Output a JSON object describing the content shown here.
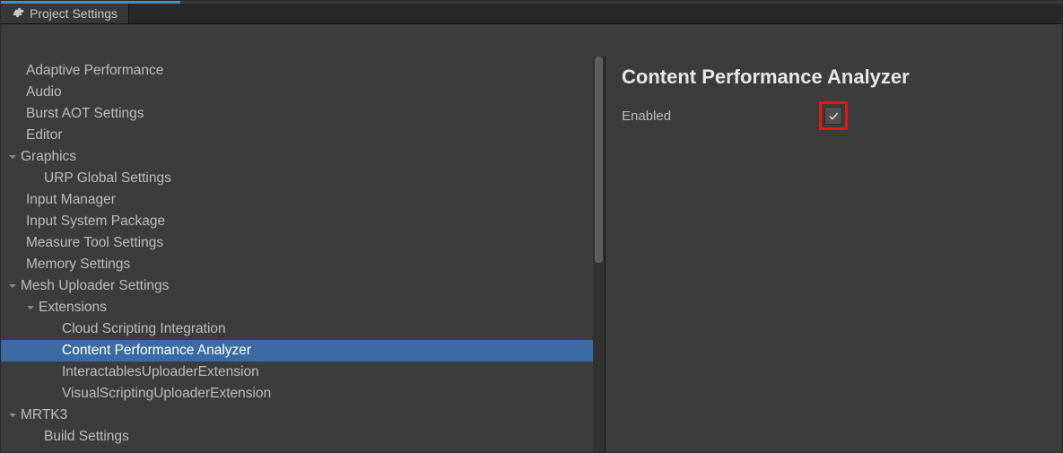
{
  "tab": {
    "title": "Project Settings",
    "icon": "gear-icon"
  },
  "tree": [
    {
      "label": "Adaptive Performance",
      "depth": 1,
      "children": false,
      "selected": false
    },
    {
      "label": "Audio",
      "depth": 1,
      "children": false,
      "selected": false
    },
    {
      "label": "Burst AOT Settings",
      "depth": 1,
      "children": false,
      "selected": false
    },
    {
      "label": "Editor",
      "depth": 1,
      "children": false,
      "selected": false
    },
    {
      "label": "Graphics",
      "depth": 0,
      "children": true,
      "expanded": true,
      "selected": false
    },
    {
      "label": "URP Global Settings",
      "depth": 2,
      "children": false,
      "selected": false
    },
    {
      "label": "Input Manager",
      "depth": 1,
      "children": false,
      "selected": false
    },
    {
      "label": "Input System Package",
      "depth": 1,
      "children": false,
      "selected": false
    },
    {
      "label": "Measure Tool Settings",
      "depth": 1,
      "children": false,
      "selected": false
    },
    {
      "label": "Memory Settings",
      "depth": 1,
      "children": false,
      "selected": false
    },
    {
      "label": "Mesh Uploader Settings",
      "depth": 0,
      "children": true,
      "expanded": true,
      "selected": false
    },
    {
      "label": "Extensions",
      "depth": 1,
      "children": true,
      "expanded": true,
      "selected": false
    },
    {
      "label": "Cloud Scripting Integration",
      "depth": 3,
      "children": false,
      "selected": false
    },
    {
      "label": "Content Performance Analyzer",
      "depth": 3,
      "children": false,
      "selected": true
    },
    {
      "label": "InteractablesUploaderExtension",
      "depth": 3,
      "children": false,
      "selected": false
    },
    {
      "label": "VisualScriptingUploaderExtension",
      "depth": 3,
      "children": false,
      "selected": false
    },
    {
      "label": "MRTK3",
      "depth": 0,
      "children": true,
      "expanded": true,
      "selected": false
    },
    {
      "label": "Build Settings",
      "depth": 2,
      "children": false,
      "selected": false
    }
  ],
  "panel": {
    "title": "Content Performance Analyzer",
    "enabled_label": "Enabled",
    "enabled_value": true,
    "highlighted": true
  }
}
